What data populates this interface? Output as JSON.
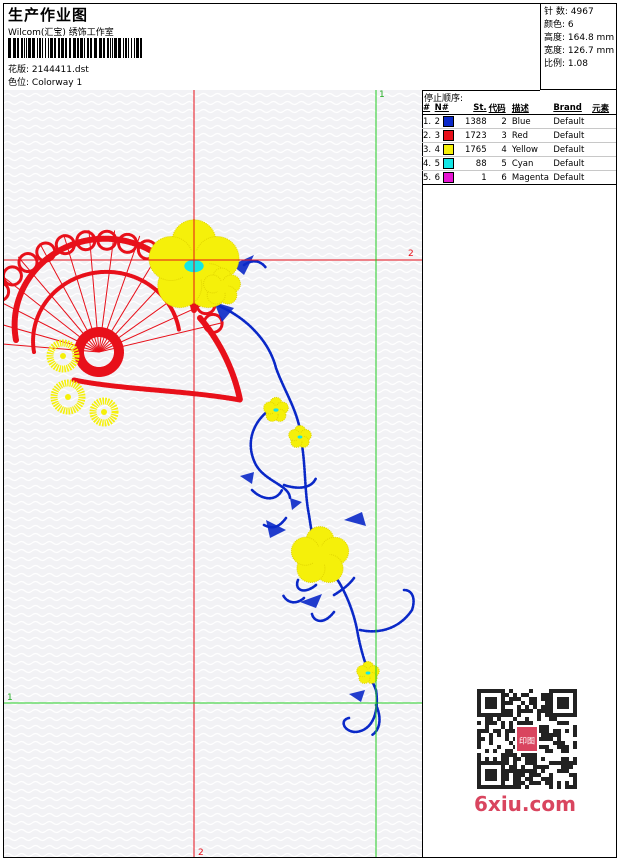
{
  "header": {
    "title": "生产作业图",
    "studio": "Wilcom(汇宝) 绣饰工作室",
    "design_label": "花版:",
    "design_value": "2144411.dst",
    "colorway_label": "色位:",
    "colorway_value": "Colorway 1"
  },
  "stats": {
    "stitches_label": "针 数:",
    "stitches_value": "4967",
    "colors_label": "颜色:",
    "colors_value": "6",
    "height_label": "高度:",
    "height_value": "164.8 mm",
    "width_label": "宽度:",
    "width_value": "126.7 mm",
    "scale_label": "比例:",
    "scale_value": "1.08"
  },
  "stop_panel": {
    "title": "停止顺序:",
    "columns": [
      "#",
      "N#",
      "St.",
      "代码",
      "描述",
      "Brand",
      "元素"
    ],
    "rows": [
      {
        "idx": "1.",
        "n": "2",
        "color": "#0a28c8",
        "st": "1388",
        "code": "2",
        "desc": "Blue",
        "brand": "Default"
      },
      {
        "idx": "2.",
        "n": "3",
        "color": "#e8101a",
        "st": "1723",
        "code": "3",
        "desc": "Red",
        "brand": "Default"
      },
      {
        "idx": "3.",
        "n": "4",
        "color": "#f5f00a",
        "st": "1765",
        "code": "4",
        "desc": "Yellow",
        "brand": "Default"
      },
      {
        "idx": "4.",
        "n": "5",
        "color": "#14e6e6",
        "st": "88",
        "code": "5",
        "desc": "Cyan",
        "brand": "Default"
      },
      {
        "idx": "5.",
        "n": "6",
        "color": "#e614d2",
        "st": "1",
        "code": "6",
        "desc": "Magenta",
        "brand": "Default"
      }
    ]
  },
  "guides": {
    "v1": "1",
    "h2": "2",
    "h1": "1",
    "v2": "2"
  },
  "watermark": {
    "site": "6xiu.com",
    "seal": "印图"
  },
  "colors": {
    "red": "#e8101a",
    "yellow": "#f5f00a",
    "blue": "#0a28c8",
    "cyan": "#14e6e6",
    "guide_red": "#e8101a",
    "guide_green": "#22cc22"
  }
}
